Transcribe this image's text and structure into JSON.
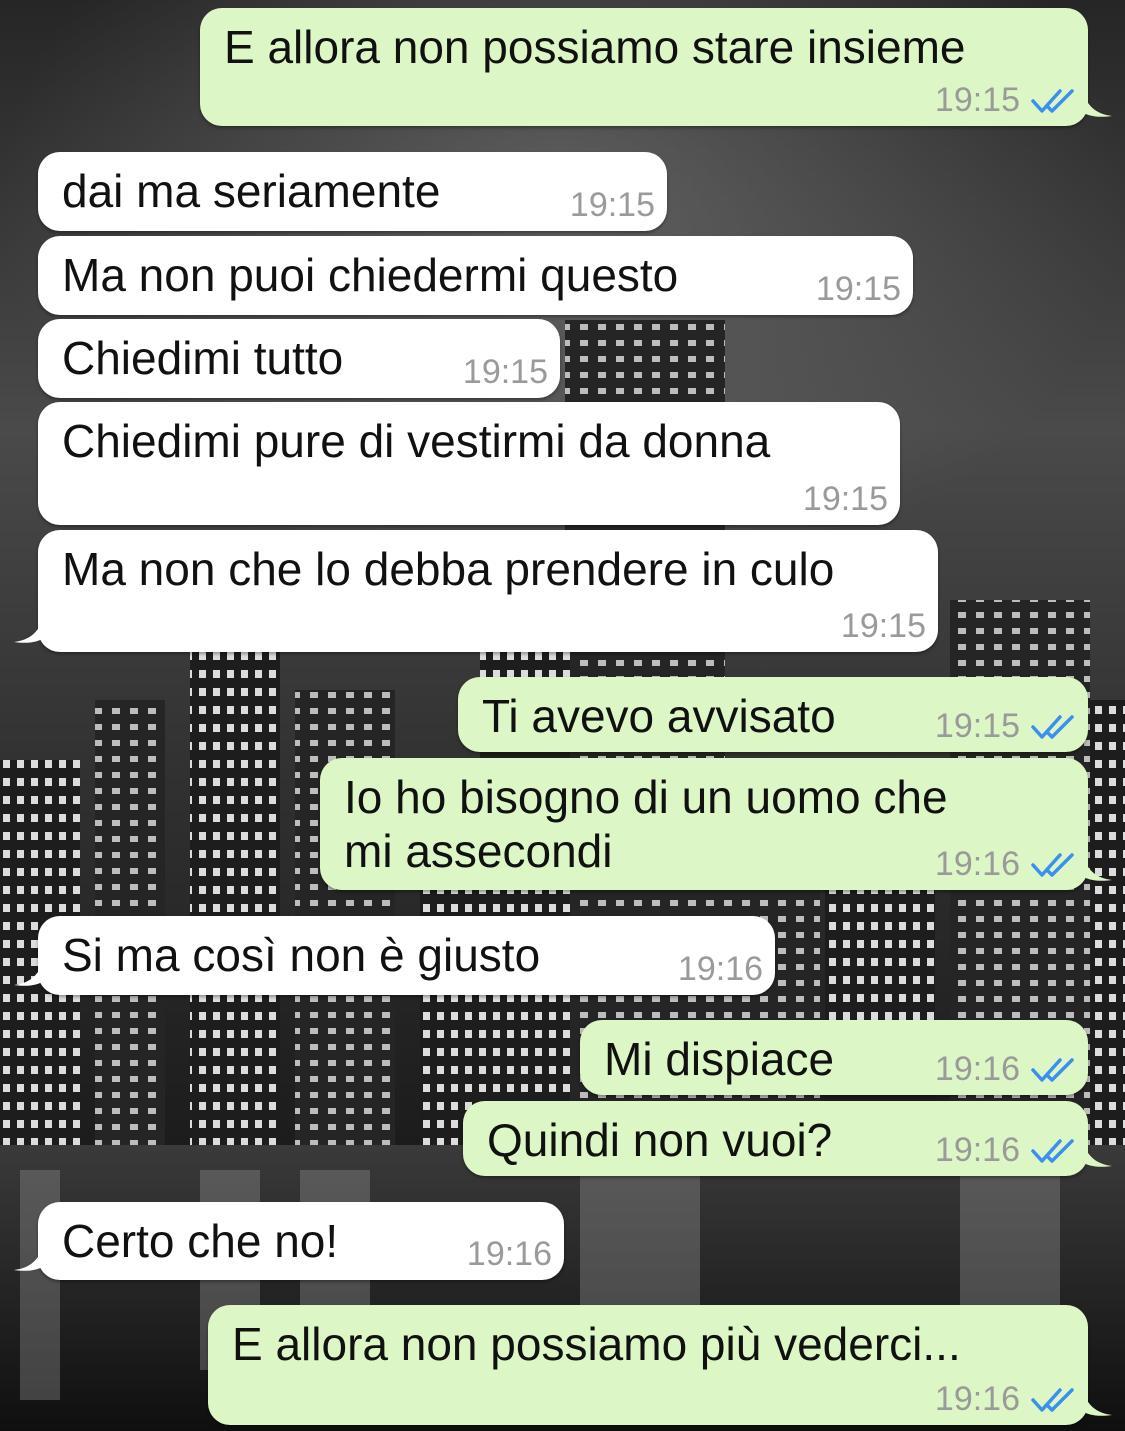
{
  "chat": {
    "read_tick_color": "#3b8ff0",
    "messages": [
      {
        "dir": "out",
        "text": "E allora non possiamo stare insieme",
        "time": "19:15",
        "ticks": "double-check-icon"
      },
      {
        "dir": "in",
        "text": "dai ma seriamente",
        "time": "19:15"
      },
      {
        "dir": "in",
        "text": "Ma non puoi chiedermi questo",
        "time": "19:15"
      },
      {
        "dir": "in",
        "text": "Chiedimi tutto",
        "time": "19:15"
      },
      {
        "dir": "in",
        "text": "Chiedimi pure di vestirmi da donna",
        "time": "19:15"
      },
      {
        "dir": "in",
        "text": "Ma non che lo debba prendere in culo",
        "time": "19:15"
      },
      {
        "dir": "out",
        "text": "Ti avevo avvisato",
        "time": "19:15",
        "ticks": "double-check-icon"
      },
      {
        "dir": "out",
        "text": "Io ho bisogno di un uomo che\nmi assecondi",
        "time": "19:16",
        "ticks": "double-check-icon"
      },
      {
        "dir": "in",
        "text": "Si ma così non è giusto",
        "time": "19:16"
      },
      {
        "dir": "out",
        "text": "Mi dispiace",
        "time": "19:16",
        "ticks": "double-check-icon"
      },
      {
        "dir": "out",
        "text": "Quindi non vuoi?",
        "time": "19:16",
        "ticks": "double-check-icon"
      },
      {
        "dir": "in",
        "text": "Certo che no!",
        "time": "19:16"
      },
      {
        "dir": "out",
        "text": "E allora non possiamo più vederci...",
        "time": "19:16",
        "ticks": "double-check-icon"
      }
    ]
  }
}
